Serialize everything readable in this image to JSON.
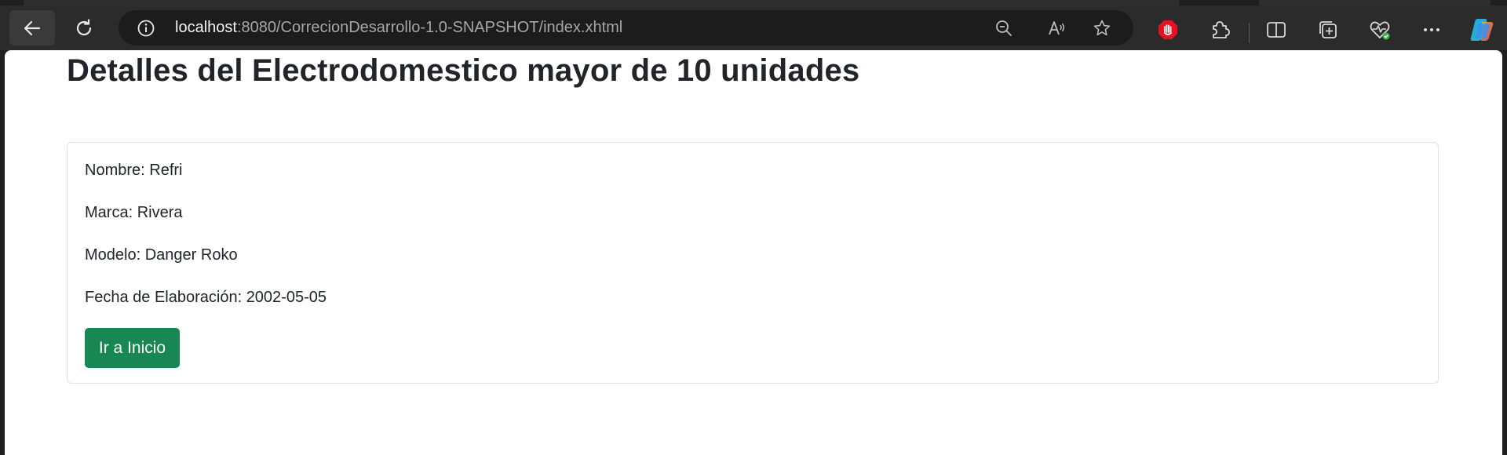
{
  "browser": {
    "address": {
      "host": "localhost",
      "rest": ":8080/CorrecionDesarrollo-1.0-SNAPSHOT/index.xhtml"
    },
    "icons": {
      "back": "back-arrow-icon",
      "reload": "reload-icon",
      "site_info": "info-icon",
      "zoom": "zoom-out-icon",
      "read_aloud": "read-aloud-icon",
      "favorite": "star-icon",
      "adblock": "stop-hand-icon",
      "extensions": "puzzle-icon",
      "split_screen": "split-screen-icon",
      "collections": "collections-icon",
      "health": "browser-essentials-icon",
      "menu": "ellipsis-icon",
      "copilot": "copilot-icon"
    },
    "colors": {
      "toolbar": "#2b2b2b",
      "adblock_red": "#e81123",
      "health_green": "#3bb54a"
    }
  },
  "page": {
    "title": "Detalles del Electrodomestico mayor de 10 unidades",
    "details": [
      {
        "label": "Nombre: ",
        "value": "Refri"
      },
      {
        "label": "Marca: ",
        "value": "Rivera"
      },
      {
        "label": "Modelo: ",
        "value": "Danger Roko"
      },
      {
        "label": "Fecha de Elaboración: ",
        "value": "2002-05-05"
      }
    ],
    "home_button": "Ir a Inicio",
    "colors": {
      "button": "#198754",
      "text": "#212529",
      "card_border": "#dee2e6"
    }
  }
}
